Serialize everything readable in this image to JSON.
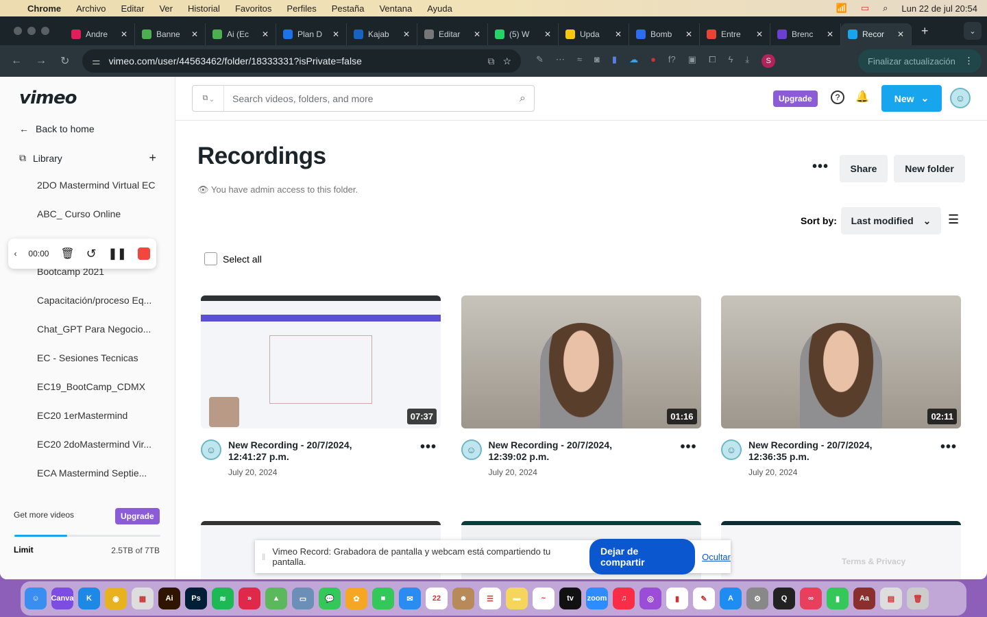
{
  "menubar": {
    "app": "Chrome",
    "items": [
      "Archivo",
      "Editar",
      "Ver",
      "Historial",
      "Favoritos",
      "Perfiles",
      "Pestaña",
      "Ventana",
      "Ayuda"
    ],
    "clock": "Lun 22 de jul  20:54"
  },
  "tabs": [
    {
      "title": "Andre",
      "color": "#e01e5a"
    },
    {
      "title": "Banne",
      "color": "#4caf50"
    },
    {
      "title": "Ai (Ec",
      "color": "#4caf50"
    },
    {
      "title": "Plan D",
      "color": "#1a73e8"
    },
    {
      "title": "Kajab",
      "color": "#1565c0"
    },
    {
      "title": "Editar",
      "color": "#777"
    },
    {
      "title": "(5) W",
      "color": "#25d366"
    },
    {
      "title": "Upda",
      "color": "#f6c90e"
    },
    {
      "title": "Bomb",
      "color": "#2b6cf0"
    },
    {
      "title": "Entre",
      "color": "#ea4335"
    },
    {
      "title": "Brenc",
      "color": "#6b3fd4"
    },
    {
      "title": "Recor",
      "color": "#17a6ee",
      "active": true
    }
  ],
  "address": {
    "url": "vimeo.com/user/44563462/folder/18333331?isPrivate=false",
    "update_button": "Finalizar actualización",
    "profile_initial": "S"
  },
  "sidebar": {
    "logo": "vimeo",
    "back": "Back to home",
    "library": "Library",
    "folders": [
      "2DO Mastermind Virtual EC",
      "ABC_ Curso Online",
      "Bootcamp 2021",
      "Capacitación/proceso Eq...",
      "Chat_GPT Para Negocio...",
      "EC - Sesiones Tecnicas",
      "EC19_BootCamp_CDMX",
      "EC20 1erMastermind",
      "EC20 2doMastermind Vir...",
      "ECA Mastermind Septie..."
    ],
    "get_more": "Get more videos",
    "upgrade": "Upgrade",
    "limit_label": "Limit",
    "limit_value": "2.5TB of 7TB",
    "usage_fraction": 0.36
  },
  "recorder": {
    "time": "00:00"
  },
  "header": {
    "search_placeholder": "Search videos, folders, and more",
    "upgrade": "Upgrade",
    "new": "New"
  },
  "main": {
    "title": "Recordings",
    "access_note": "You have admin access to this folder.",
    "share": "Share",
    "new_folder": "New folder",
    "sort_label": "Sort by:",
    "sort_value": "Last modified",
    "select_all": "Select all",
    "videos": [
      {
        "title": "New Recording - 20/7/2024, 12:41:27 p.m.",
        "date": "July 20, 2024",
        "duration": "07:37",
        "kind": "screen"
      },
      {
        "title": "New Recording - 20/7/2024, 12:39:02 p.m.",
        "date": "July 20, 2024",
        "duration": "01:16",
        "kind": "webcam"
      },
      {
        "title": "New Recording - 20/7/2024, 12:36:35 p.m.",
        "date": "July 20, 2024",
        "duration": "02:11",
        "kind": "webcam"
      }
    ],
    "terms": "Terms & Privacy"
  },
  "share_notice": {
    "text": "Vimeo Record: Grabadora de pantalla y webcam está compartiendo tu pantalla.",
    "stop": "Dejar de compartir",
    "hide": "Ocultar"
  },
  "dock": [
    {
      "name": "finder",
      "label": "☺",
      "color": "#3a8ef0"
    },
    {
      "name": "canva",
      "label": "Canva",
      "color": "#7d4ce0"
    },
    {
      "name": "keynote",
      "label": "K",
      "color": "#1e88e5"
    },
    {
      "name": "chrome",
      "label": "◉",
      "color": "#e8b21e"
    },
    {
      "name": "launchpad",
      "label": "▦",
      "color": "#ddd"
    },
    {
      "name": "illustrator",
      "label": "Ai",
      "color": "#2f1400"
    },
    {
      "name": "photoshop",
      "label": "Ps",
      "color": "#001e36"
    },
    {
      "name": "spotify",
      "label": "≋",
      "color": "#1db954"
    },
    {
      "name": "speedify",
      "label": "»",
      "color": "#e0284a"
    },
    {
      "name": "maps",
      "label": "▲",
      "color": "#5cb85c"
    },
    {
      "name": "preview",
      "label": "▭",
      "color": "#6c8fb8"
    },
    {
      "name": "messages",
      "label": "💬",
      "color": "#34c759"
    },
    {
      "name": "photos",
      "label": "✿",
      "color": "#f5a623"
    },
    {
      "name": "facetime",
      "label": "■",
      "color": "#34c759"
    },
    {
      "name": "mail",
      "label": "✉",
      "color": "#2a8cf0"
    },
    {
      "name": "calendar",
      "label": "22",
      "color": "#fff"
    },
    {
      "name": "contacts",
      "label": "☻",
      "color": "#b88a5a"
    },
    {
      "name": "reminders",
      "label": "☰",
      "color": "#fff"
    },
    {
      "name": "notes",
      "label": "▬",
      "color": "#f6d55c"
    },
    {
      "name": "freeform",
      "label": "~",
      "color": "#fff"
    },
    {
      "name": "apple-tv",
      "label": "tv",
      "color": "#111"
    },
    {
      "name": "zoom",
      "label": "zoom",
      "color": "#2d8cff"
    },
    {
      "name": "music",
      "label": "♫",
      "color": "#fa2d48"
    },
    {
      "name": "podcasts",
      "label": "◎",
      "color": "#9b4dd8"
    },
    {
      "name": "numbers",
      "label": "▮",
      "color": "#fff"
    },
    {
      "name": "pages",
      "label": "✎",
      "color": "#fff"
    },
    {
      "name": "app-store",
      "label": "A",
      "color": "#1e8cf0"
    },
    {
      "name": "system-settings",
      "label": "⚙",
      "color": "#888"
    },
    {
      "name": "quicktime",
      "label": "Q",
      "color": "#222"
    },
    {
      "name": "creative-cloud",
      "label": "∞",
      "color": "#e8405c"
    },
    {
      "name": "find-my",
      "label": "▮",
      "color": "#34c759"
    },
    {
      "name": "dictionary",
      "label": "Aa",
      "color": "#8b2e2e"
    },
    {
      "name": "downloads",
      "label": "▤",
      "color": "#ddd"
    },
    {
      "name": "trash",
      "label": "🗑",
      "color": "#ccc"
    }
  ]
}
